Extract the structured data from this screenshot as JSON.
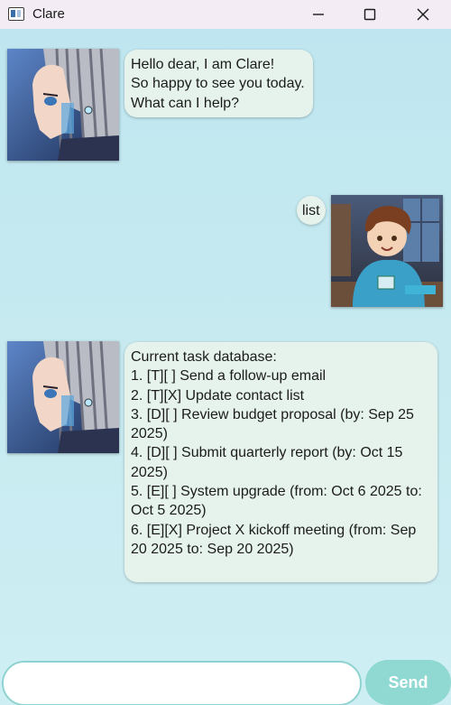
{
  "window": {
    "title": "Clare",
    "icon": "app-window-icon",
    "controls": [
      "minimize-icon",
      "maximize-icon",
      "close-icon"
    ]
  },
  "chat": {
    "messages": [
      {
        "sender": "bot",
        "avatar": "clare-avatar",
        "text": "Hello dear, I am Clare!\nSo happy to see you today.\nWhat can I help?"
      },
      {
        "sender": "user",
        "avatar": "user-avatar",
        "text": "list"
      },
      {
        "sender": "bot",
        "avatar": "clare-avatar",
        "text": "Current task database:\n1. [T][ ] Send a follow-up email\n2. [T][X] Update contact list\n3. [D][ ] Review budget proposal (by: Sep 25\n2025)\n4. [D][ ] Submit quarterly report (by: Oct 15\n2025)\n5. [E][ ] System upgrade (from: Oct 6 2025 to:\nOct 5 2025)\n6. [E][X] Project X kickoff meeting (from: Sep\n20 2025 to: Sep 20 2025)"
      }
    ]
  },
  "input": {
    "value": "",
    "placeholder": ""
  },
  "send": {
    "label": "Send"
  },
  "colors": {
    "background": "#c6eaf0",
    "bubble": "#e6f3ec",
    "accent": "#90d8d2"
  }
}
